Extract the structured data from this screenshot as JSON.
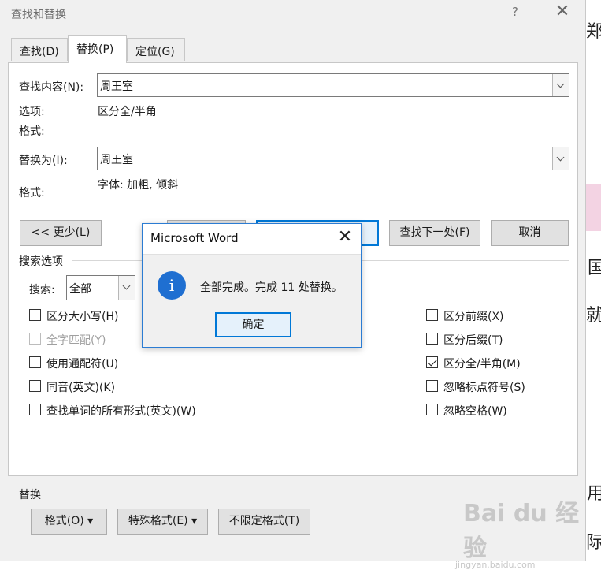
{
  "background_doc": {
    "chars": [
      "郑",
      "国",
      "就",
      "用",
      "际"
    ]
  },
  "dialog": {
    "title": "查找和替换",
    "help": "?",
    "close": "✕",
    "tabs": [
      {
        "label": "查找(D)"
      },
      {
        "label": "替换(P)"
      },
      {
        "label": "定位(G)"
      }
    ],
    "find_label": "查找内容(N):",
    "find_value": "周王室",
    "options_label": "选项:",
    "options_value": "区分全/半角",
    "format_label_1": "格式:",
    "replace_label": "替换为(I):",
    "replace_value": "周王室",
    "format_label_2": "格式:",
    "format_value_2": "字体: 加粗, 倾斜",
    "less_button": "<< 更少(L)",
    "find_next_button": "查找下一处(F)",
    "cancel_button": "取消",
    "search_options_title": "搜索选项",
    "search_label": "搜索:",
    "search_value": "全部",
    "left_checks": [
      {
        "label": "区分大小写(H)",
        "checked": false,
        "disabled": false
      },
      {
        "label": "全字匹配(Y)",
        "checked": false,
        "disabled": true
      },
      {
        "label": "使用通配符(U)",
        "checked": false,
        "disabled": false
      },
      {
        "label": "同音(英文)(K)",
        "checked": false,
        "disabled": false
      },
      {
        "label": "查找单词的所有形式(英文)(W)",
        "checked": false,
        "disabled": false
      }
    ],
    "right_checks": [
      {
        "label": "区分前缀(X)",
        "checked": false
      },
      {
        "label": "区分后缀(T)",
        "checked": false
      },
      {
        "label": "区分全/半角(M)",
        "checked": true
      },
      {
        "label": "忽略标点符号(S)",
        "checked": false
      },
      {
        "label": "忽略空格(W)",
        "checked": false
      }
    ],
    "replace_section_title": "替换",
    "format_button": "格式(O) ▾",
    "special_button": "特殊格式(E) ▾",
    "no_format_button": "不限定格式(T)"
  },
  "msgbox": {
    "title": "Microsoft Word",
    "close": "✕",
    "icon_glyph": "i",
    "message": "全部完成。完成 11 处替换。",
    "ok": "确定"
  },
  "watermark": {
    "brand": "Bai du 经验",
    "sub": "jingyan.baidu.com"
  }
}
